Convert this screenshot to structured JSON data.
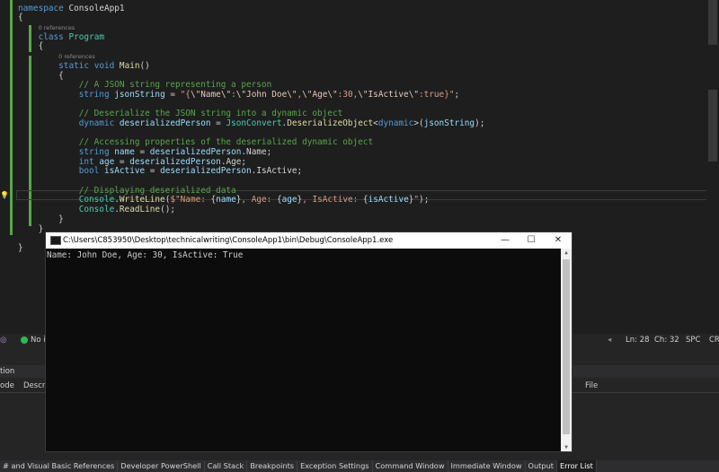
{
  "editor": {
    "lines": [
      {
        "cls": "l0"
      },
      {
        "cls": "l1"
      }
    ],
    "namespace_kw": "namespace",
    "namespace_name": "ConsoleApp1",
    "class_kw": "class",
    "class_name": "Program",
    "refs": "0 references",
    "static_kw": "static",
    "void_kw": "void",
    "main_name": "Main",
    "comment1": "// A JSON string representing a person",
    "string_kw": "string",
    "var_json": "jsonString",
    "json_literal_a": "\"{",
    "json_literal_b": "\\\"Name\\\"",
    "json_literal_c": ":",
    "json_literal_d": "\\\"John Doe\\\"",
    "json_literal_e": ",",
    "json_literal_f": "\\\"Age\\\"",
    "json_literal_g": ":30,",
    "json_literal_h": "\\\"IsActive\\\"",
    "json_literal_i": ":true}\"",
    "comment2": "// Deserialize the JSON string into a dynamic object",
    "dynamic_kw": "dynamic",
    "var_person": "deserializedPerson",
    "jsonconvert": "JsonConvert",
    "deserialize_fn": "DeserializeObject",
    "comment3": "// Accessing properties of the deserialized dynamic object",
    "var_name": "name",
    "prop_name": "Name",
    "int_kw": "int",
    "var_age": "age",
    "prop_age": "Age",
    "bool_kw": "bool",
    "var_active": "isActive",
    "prop_active": "IsActive",
    "comment4": "// Displaying deserialized data",
    "console_cls": "Console",
    "writeline_fn": "WriteLine",
    "readline_fn": "ReadLine",
    "interp_a": "$\"Name: ",
    "interp_b": ", Age: ",
    "interp_c": ", IsActive: ",
    "interp_d": "\""
  },
  "status": {
    "issues": "No is",
    "ln": "Ln: 28",
    "ch": "Ch: 32",
    "spc": "SPC",
    "crlf": "CRL"
  },
  "panel": {
    "title": "tion",
    "col_code": "ode",
    "col_desc": "Descrip",
    "col_file": "File"
  },
  "tabs": [
    "# and Visual Basic References",
    "Developer PowerShell",
    "Call Stack",
    "Breakpoints",
    "Exception Settings",
    "Command Window",
    "Immediate Window",
    "Output",
    "Error List"
  ],
  "console": {
    "title": "C:\\Users\\C853950\\Desktop\\technicalwriting\\ConsoleApp1\\bin\\Debug\\ConsoleApp1.exe",
    "output": "Name: John Doe, Age: 30, IsActive: True",
    "minimize": "—",
    "maximize": "☐",
    "close": "✕"
  }
}
